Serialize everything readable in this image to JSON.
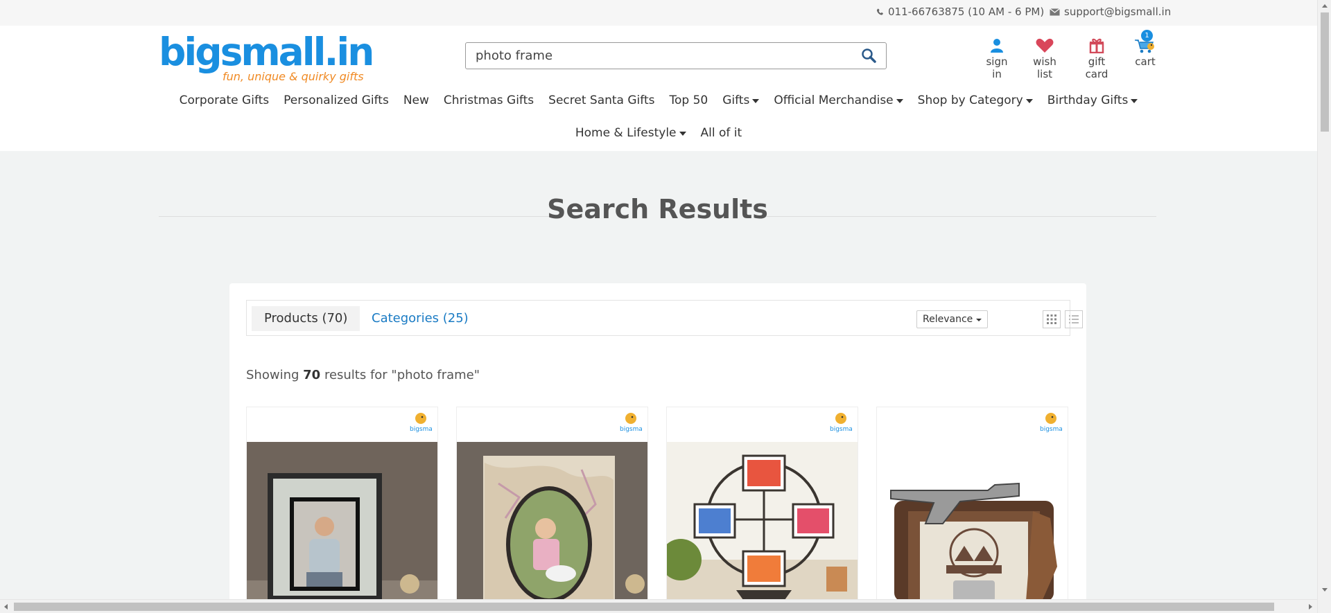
{
  "topbar": {
    "phone": "011-66763875 (10 AM - 6 PM)",
    "email": "support@bigsmall.in"
  },
  "logo": {
    "name": "bigsmall.in",
    "tagline": "fun, unique & quirky gifts"
  },
  "search": {
    "value": "photo frame",
    "placeholder": ""
  },
  "header_links": {
    "sign_in": "sign in",
    "wish_list": "wish list",
    "gift_card": "gift card",
    "cart": "cart",
    "cart_count": "1"
  },
  "nav": {
    "row1": [
      "Corporate Gifts",
      "Personalized Gifts",
      "New",
      "Christmas Gifts",
      "Secret Santa Gifts",
      "Top 50",
      "Gifts",
      "Official Merchandise",
      "Shop by Category",
      "Birthday Gifts"
    ],
    "row2": [
      "Home & Lifestyle",
      "All of it"
    ]
  },
  "page": {
    "title": "Search Results"
  },
  "results": {
    "tab_products": "Products (70)",
    "tab_categories": "Categories (25)",
    "sort_value": "Relevance",
    "summary_prefix": "Showing",
    "summary_count": "70",
    "summary_suffix": "results for \"photo frame\""
  },
  "products": [
    {
      "image": "man-in-black-frame"
    },
    {
      "image": "girl-in-oval-map-frame"
    },
    {
      "image": "ferris-wheel-frame"
    },
    {
      "image": "western-revolver-frame"
    }
  ],
  "colors": {
    "brand_blue": "#1a8fe0",
    "brand_orange": "#f08a24",
    "link_blue": "#1a7bc4",
    "heart": "#d9465a",
    "gift": "#d24a5a",
    "user": "#1a8fe0"
  }
}
